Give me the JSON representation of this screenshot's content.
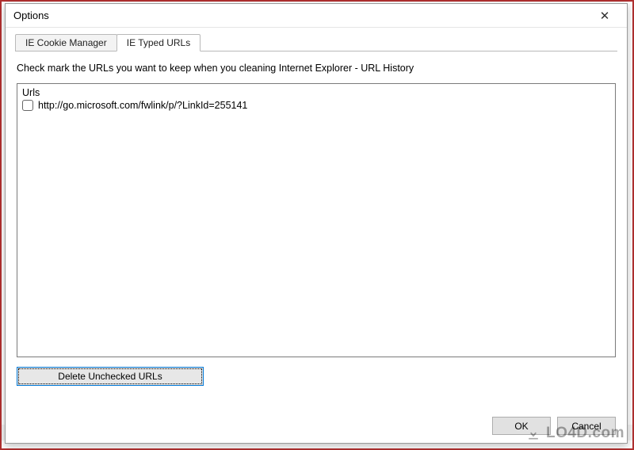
{
  "dialog": {
    "title": "Options",
    "close_symbol": "✕",
    "tabs": {
      "cookie": "IE Cookie Manager",
      "typed": "IE Typed URLs"
    },
    "instruction": "Check mark the URLs you want to keep when you cleaning Internet Explorer - URL History",
    "url_header": "Urls",
    "items": [
      {
        "url": "http://go.microsoft.com/fwlink/p/?LinkId=255141",
        "checked": false
      }
    ],
    "delete_label": "Delete Unchecked URLs",
    "ok_label": "OK",
    "cancel_label": "Cancel"
  },
  "watermark": "LO4D.com"
}
